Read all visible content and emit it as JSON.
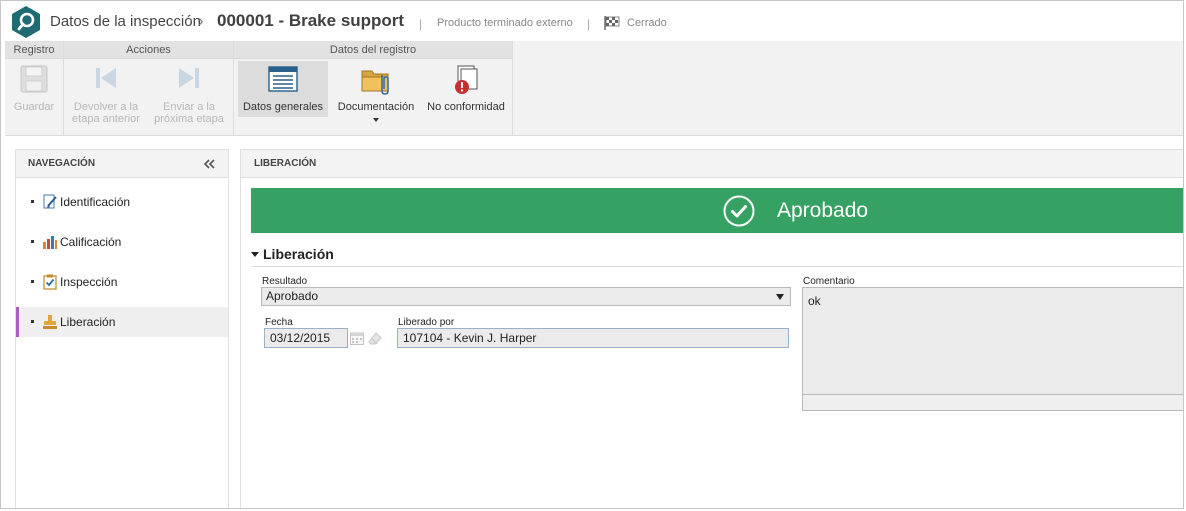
{
  "titlebar": {
    "app_title": "Datos de la inspección",
    "record_title": "000001 - Brake support",
    "category": "Producto terminado externo",
    "status": "Cerrado"
  },
  "ribbon": {
    "groups": {
      "registro": "Registro",
      "acciones": "Acciones",
      "datos": "Datos del registro"
    },
    "buttons": {
      "save": "Guardar",
      "back_1": "Devolver a la",
      "back_2": "etapa anterior",
      "next_1": "Enviar a la",
      "next_2": "próxima etapa",
      "general": "Datos generales",
      "docs": "Documentación",
      "nonconf": "No conformidad"
    }
  },
  "nav": {
    "header": "NAVEGACIÓN",
    "items": [
      {
        "label": "Identificación",
        "icon": "edit-doc-icon"
      },
      {
        "label": "Calificación",
        "icon": "bar-chart-icon"
      },
      {
        "label": "Inspección",
        "icon": "checklist-icon"
      },
      {
        "label": "Liberación",
        "icon": "stamp-icon"
      }
    ],
    "selected": "Liberación"
  },
  "main": {
    "header": "LIBERACIÓN",
    "status_banner": "Aprobado",
    "section_title": "Liberación",
    "resultado_label": "Resultado",
    "resultado_value": "Aprobado",
    "fecha_label": "Fecha",
    "fecha_value": "03/12/2015",
    "liberado_label": "Liberado por",
    "liberado_value": "107104 - Kevin J. Harper",
    "comentario_label": "Comentario",
    "comentario_value": "ok"
  },
  "colors": {
    "accent_green": "#35a163",
    "nav_selected": "#a95fc0",
    "logo_teal": "#1f6b73"
  }
}
